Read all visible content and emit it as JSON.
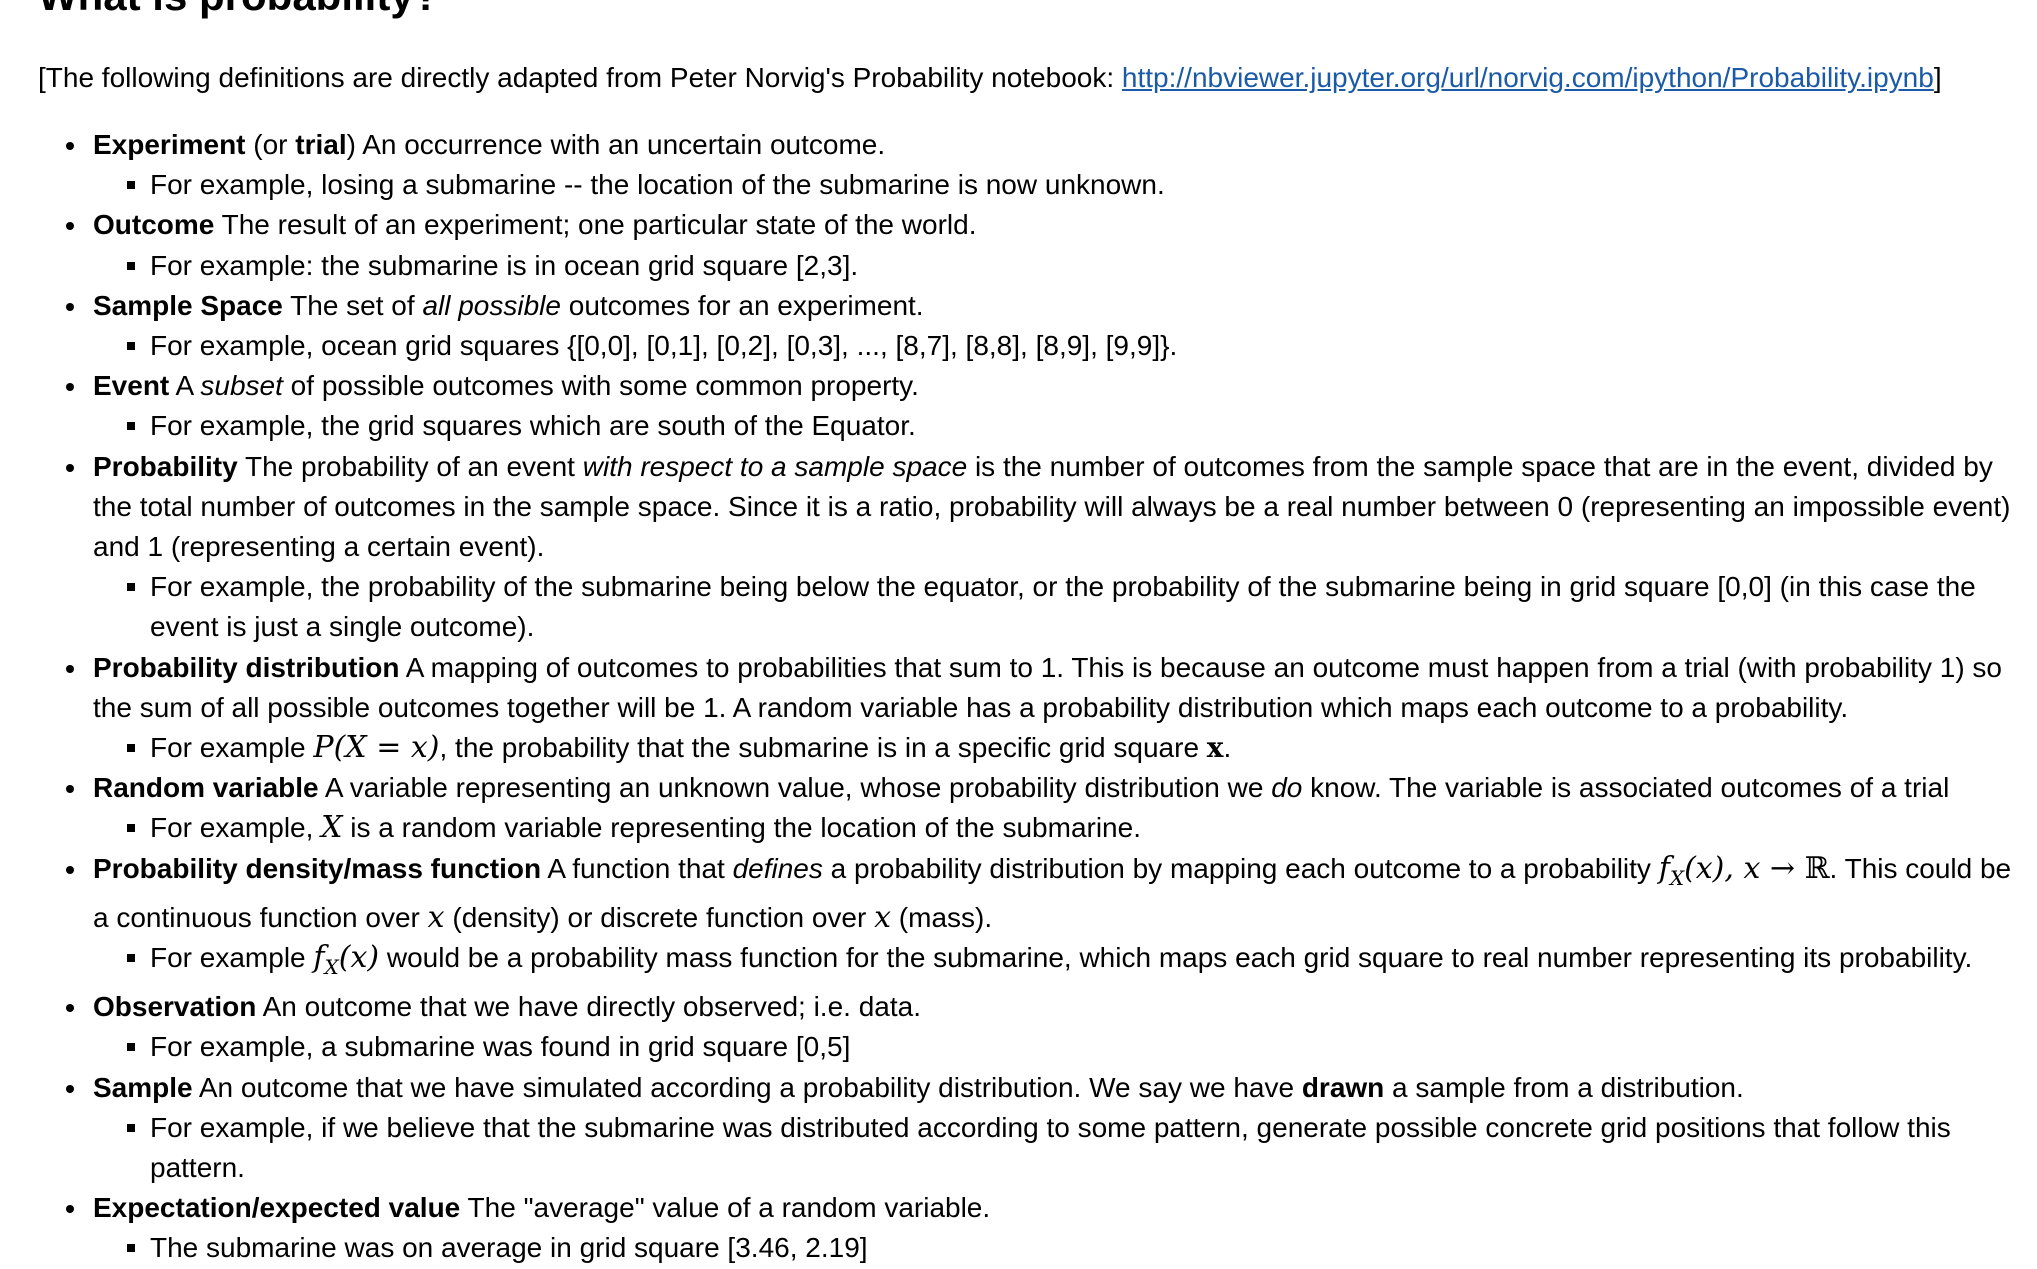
{
  "heading": "What is probability?",
  "attribution": {
    "prefix": "[The following definitions are directly adapted from Peter Norvig's Probability notebook: ",
    "link_text": "http://nbviewer.jupyter.org/url/norvig.com/ipython/Probability.ipynb",
    "suffix": "]",
    "link_color": "#1a5aa6"
  },
  "definitions": [
    {
      "term": "Experiment",
      "open_paren": " (or ",
      "term2": "trial",
      "rest": ") An occurrence with an uncertain outcome.",
      "example": "For example, losing a submarine -- the location of the submarine is now unknown."
    },
    {
      "term": "Outcome",
      "rest": " The result of an experiment; one particular state of the world.",
      "example": "For example: the submarine is in ocean grid square [2,3]."
    },
    {
      "term": "Sample Space",
      "pre": " The set of ",
      "em": "all possible",
      "rest": " outcomes for an experiment.",
      "example": "For example, ocean grid squares {[0,0], [0,1], [0,2], [0,3], ..., [8,7], [8,8], [8,9], [9,9]}."
    },
    {
      "term": "Event",
      "pre": " A ",
      "em": "subset",
      "rest": " of possible outcomes with some common property.",
      "example": "For example, the grid squares which are south of the Equator."
    },
    {
      "term": "Probability",
      "pre": " The probability of an event ",
      "em": "with respect to a sample space",
      "rest": " is the number of outcomes from the sample space that are in the event, divided by the total number of outcomes in the sample space. Since it is a ratio, probability will always be a real number between 0 (representing an impossible event) and 1 (representing a certain event).",
      "example": "For example, the probability of the submarine being below the equator, or the probability of the submarine being in grid square [0,0] (in this case the event is just a single outcome)."
    },
    {
      "term": "Probability distribution",
      "rest": " A mapping of outcomes to probabilities that sum to 1. This is because an outcome must happen from a trial (with probability 1) so the sum of all possible outcomes together will be 1. A random variable has a probability distribution which maps each outcome to a probability.",
      "example_pre": "For example ",
      "example_math": "P(X = x)",
      "example_mid": ", the probability that the submarine is in a specific grid square ",
      "example_math2": "x",
      "example_post": "."
    },
    {
      "term": "Random variable",
      "pre": " A variable representing an unknown value, whose probability distribution we ",
      "em": "do",
      "rest": " know. The variable is associated outcomes of a trial",
      "example_pre": "For example, ",
      "example_math": "X",
      "example_post": " is a random variable representing the location of the submarine."
    },
    {
      "term": "Probability density/mass function",
      "pre": " A function that ",
      "em": "defines",
      "mid": " a probability distribution by mapping each outcome to a probability ",
      "math1_f": "f",
      "math1_sub": "X",
      "math1_rest": "(x), x → ",
      "math1_reals": "ℝ",
      "mid2": ". This could be a continuous function over ",
      "math2": "x",
      "mid3": " (density) or discrete function over ",
      "math3": "x",
      "rest": " (mass).",
      "example_pre": "For example ",
      "example_math_f": "f",
      "example_math_sub": "X",
      "example_math_rest": "(x)",
      "example_post": " would be a probability mass function for the submarine, which maps each grid square to real number representing its probability."
    },
    {
      "term": "Observation",
      "rest": " An outcome that we have directly observed; i.e. data.",
      "example": "For example, a submarine was found in grid square [0,5]"
    },
    {
      "term": "Sample",
      "pre": " An outcome that we have simulated according a probability distribution. We say we have ",
      "strong": "drawn",
      "rest": " a sample from a distribution.",
      "example": "For example, if we believe that the submarine was distributed according to some pattern, generate possible concrete grid positions that follow this pattern."
    },
    {
      "term": "Expectation/expected value",
      "rest": " The \"average\" value of a random variable.",
      "example": "The submarine was on average in grid square [3.46, 2.19]"
    }
  ]
}
